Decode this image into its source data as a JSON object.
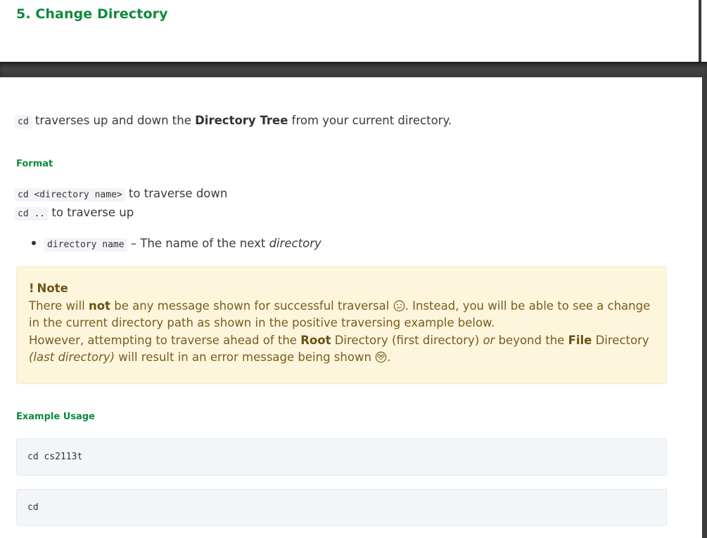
{
  "section": {
    "title": "5. Change Directory"
  },
  "intro": {
    "code": "cd",
    "text_before": " traverses up and down the ",
    "bold": "Directory Tree",
    "text_after": " from your current directory."
  },
  "format": {
    "heading": "Format",
    "lines": [
      {
        "code": "cd <directory name>",
        "text": " to traverse down"
      },
      {
        "code": "cd ..",
        "text": " to traverse up"
      }
    ],
    "bullet": {
      "code": "directory name",
      "text": " – The name of the next ",
      "italic": "directory"
    }
  },
  "note": {
    "title": "Note",
    "line1_a": "There will ",
    "line1_bold": "not",
    "line1_b": " be any message shown for successful traversal ",
    "line1_c": ". Instead, you will be able to see a change in the current directory path as shown in the positive traversing example below.",
    "line2_a": "However, attempting to traverse ahead of the ",
    "line2_bold1": "Root",
    "line2_b": " Directory (first directory) ",
    "line2_italic1": "or",
    "line2_c": " beyond the ",
    "line2_bold2": "File",
    "line2_d": " Directory ",
    "line2_italic2": "(last directory)",
    "line2_e": " will result in an error message being shown ",
    "line2_f": ".",
    "icons": [
      "neutral-face-icon",
      "nerd-face-icon"
    ]
  },
  "example": {
    "heading": "Example Usage",
    "blocks": [
      "cd cs2113t",
      "cd"
    ]
  },
  "colors": {
    "heading_green": "#0d8a3f",
    "note_bg": "#fdf5dc",
    "note_text": "#7a5c1d",
    "code_bg": "#f3f6f9"
  }
}
